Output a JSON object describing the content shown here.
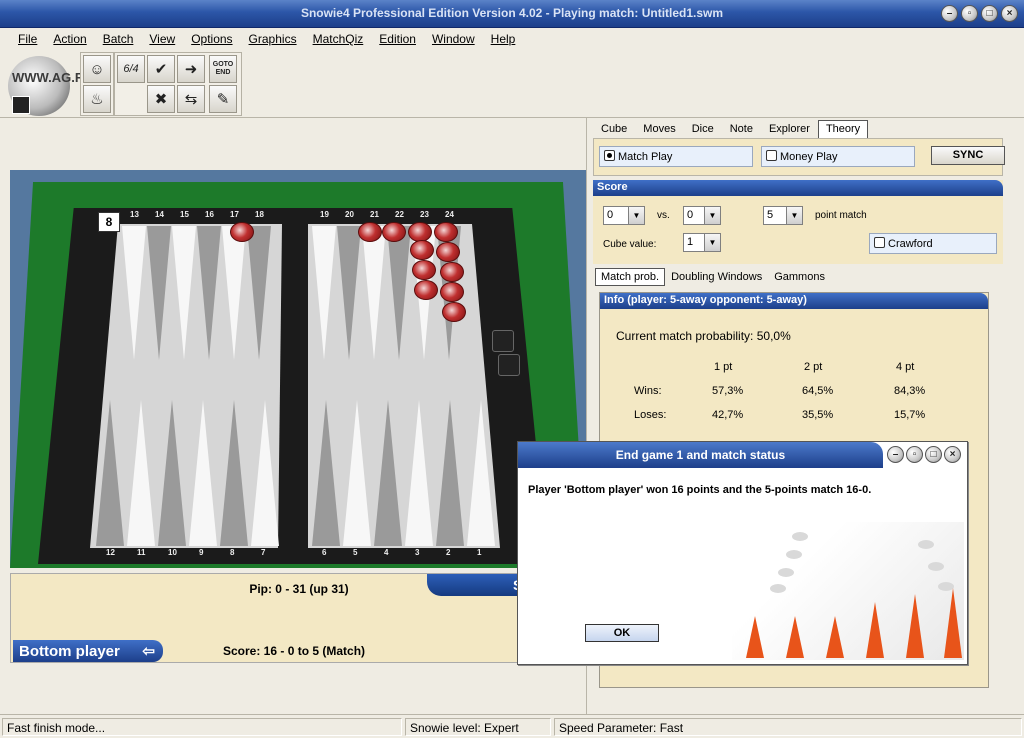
{
  "window": {
    "title": "Snowie4 Professional Edition Version 4.02 - Playing match: Untitled1.swm"
  },
  "menu": [
    "File",
    "Action",
    "Batch",
    "View",
    "Options",
    "Graphics",
    "MatchQiz",
    "Edition",
    "Window",
    "Help"
  ],
  "toolbar": {
    "watermark": "WWW.AG.RU",
    "goto_end_label": "GOTO END",
    "notation_label": "6/4"
  },
  "board": {
    "top_point_labels": [
      "13",
      "14",
      "15",
      "16",
      "17",
      "18",
      "19",
      "20",
      "21",
      "22",
      "23",
      "24"
    ],
    "bottom_point_labels": [
      "12",
      "11",
      "10",
      "9",
      "8",
      "7",
      "6",
      "5",
      "4",
      "3",
      "2",
      "1"
    ],
    "doubling_cube": "8",
    "pip": "Pip: 0 - 31 (up 31)",
    "score": "Score: 16 - 0 to 5 (Match)",
    "player_tag": "Bottom player",
    "player_tag_arrow": "⇦",
    "score_tab_letter": "S"
  },
  "right_panel": {
    "tabs": [
      "Cube",
      "Moves",
      "Dice",
      "Note",
      "Explorer",
      "Theory"
    ],
    "active_tab": "Theory",
    "match_play": "Match Play",
    "money_play": "Money Play",
    "sync": "SYNC",
    "score_header": "Score",
    "score_left": "0",
    "vs": "vs.",
    "score_right": "0",
    "match_length": "5",
    "point_match": "point match",
    "cube_value_label": "Cube value:",
    "cube_value": "1",
    "crawford": "Crawford",
    "subtabs": [
      "Match prob.",
      "Doubling Windows",
      "Gammons"
    ],
    "info_header": "Info (player: 5-away opponent: 5-away)",
    "current_prob": "Current match probability: 50,0%",
    "columns": [
      "1 pt",
      "2 pt",
      "4 pt"
    ],
    "rows": [
      {
        "label": "Wins:",
        "values": [
          "57,3%",
          "64,5%",
          "84,3%"
        ]
      },
      {
        "label": "Loses:",
        "values": [
          "42,7%",
          "35,5%",
          "15,7%"
        ]
      }
    ]
  },
  "dialog": {
    "title": "End game 1 and match status",
    "message": "Player 'Bottom player' won 16 points and the 5-points match 16-0.",
    "ok": "OK"
  },
  "status_bar": {
    "mode": "Fast finish mode...",
    "level": "Snowie level: Expert",
    "speed": "Speed Parameter: Fast"
  },
  "colors": {
    "title_blue": "#2c56a8",
    "panel_beige": "#f3e8c4",
    "felt_green": "#1d7a2a",
    "checker_red": "#c03030",
    "spike_orange": "#e8541a"
  }
}
